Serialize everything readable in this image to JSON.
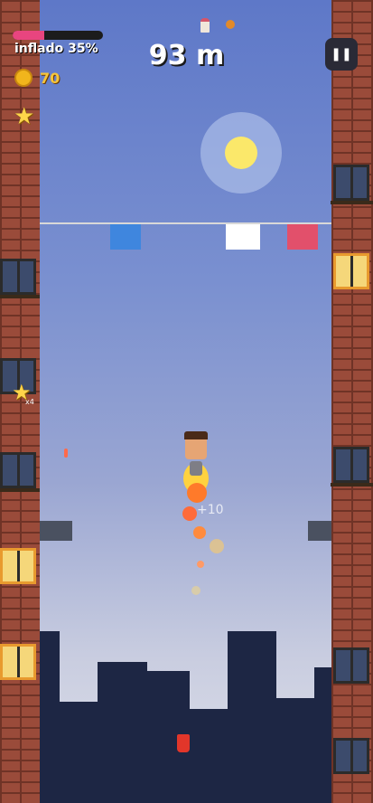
{
  "hud": {
    "inflate_label": "inflado 35%",
    "inflate_progress": 0.35,
    "coins": "70",
    "distance": "93 m",
    "multiplier": "x4",
    "popup_points": "+10"
  },
  "icons": {
    "pause": "pause-icon",
    "coin": "coin-icon",
    "star": "star-icon",
    "food_top": [
      "cupcake-icon",
      "chicken-leg-icon"
    ],
    "drink": "soda-cup-icon"
  },
  "colors": {
    "progress_fill": "#e8457f",
    "coin_text": "#f6c53a",
    "flag_blue": "#3f86de",
    "flag_white": "#ffffff",
    "flag_red": "#e2506b"
  }
}
